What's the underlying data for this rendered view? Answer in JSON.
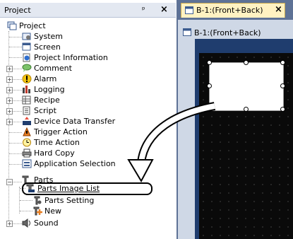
{
  "project_panel": {
    "title": "Project",
    "pin_glyph": "p",
    "close_glyph": "×",
    "items": [
      {
        "label": "Project"
      },
      {
        "label": "System"
      },
      {
        "label": "Screen"
      },
      {
        "label": "Project Information"
      },
      {
        "label": "Comment"
      },
      {
        "label": "Alarm"
      },
      {
        "label": "Logging"
      },
      {
        "label": "Recipe"
      },
      {
        "label": "Script"
      },
      {
        "label": "Device Data Transfer"
      },
      {
        "label": "Trigger Action"
      },
      {
        "label": "Time Action"
      },
      {
        "label": "Hard Copy"
      },
      {
        "label": "Application Selection"
      },
      {
        "label": "Parts"
      },
      {
        "label": "Parts Image List"
      },
      {
        "label": "Parts Setting"
      },
      {
        "label": "New"
      },
      {
        "label": "Sound"
      }
    ]
  },
  "editor": {
    "tab_label": "B-1:(Front+Back)",
    "tab_close": "×",
    "window_title": "B-1:(Front+Back)"
  },
  "colors": {
    "tab_bg": "#fff2c2",
    "canvas_bg": "#0a0a0a",
    "panel_header": "#e3e8f1"
  }
}
